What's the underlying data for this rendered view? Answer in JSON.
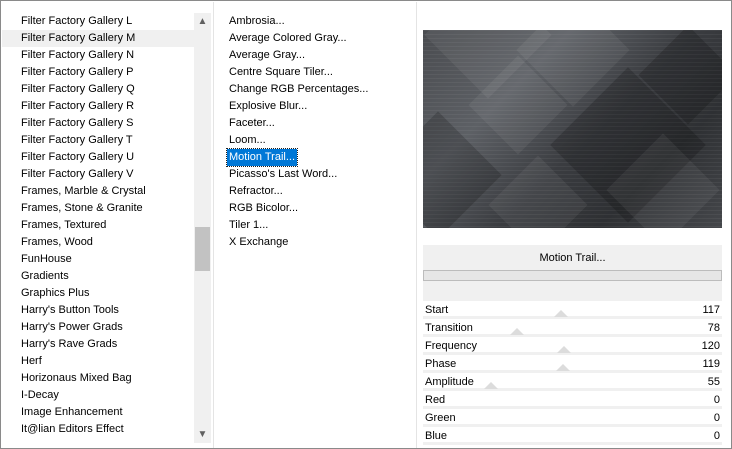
{
  "categories": {
    "items": [
      "Filter Factory Gallery L",
      "Filter Factory Gallery M",
      "Filter Factory Gallery N",
      "Filter Factory Gallery P",
      "Filter Factory Gallery Q",
      "Filter Factory Gallery R",
      "Filter Factory Gallery S",
      "Filter Factory Gallery T",
      "Filter Factory Gallery U",
      "Filter Factory Gallery V",
      "Frames, Marble & Crystal",
      "Frames, Stone & Granite",
      "Frames, Textured",
      "Frames, Wood",
      "FunHouse",
      "Gradients",
      "Graphics Plus",
      "Harry's Button Tools",
      "Harry's Power Grads",
      "Harry's Rave Grads",
      "Herf",
      "Horizonaus Mixed Bag",
      "I-Decay",
      "Image Enhancement",
      "It@lian Editors Effect"
    ],
    "selected": "Filter Factory Gallery M",
    "scroll_up_icon": "chevron-up-icon",
    "scroll_down_icon": "chevron-down-icon"
  },
  "filters": {
    "items": [
      "Ambrosia...",
      "Average Colored Gray...",
      "Average Gray...",
      "Centre Square Tiler...",
      "Change RGB Percentages...",
      "Explosive Blur...",
      "Faceter...",
      "Loom...",
      "Motion Trail...",
      "Picasso's Last Word...",
      "Refractor...",
      "RGB Bicolor...",
      "Tiler 1...",
      "X Exchange"
    ],
    "selected": "Motion Trail..."
  },
  "preview": {
    "title": "Motion Trail..."
  },
  "params": [
    {
      "name": "Start",
      "value": "117",
      "level": 117
    },
    {
      "name": "Transition",
      "value": "78",
      "level": 78
    },
    {
      "name": "Frequency",
      "value": "120",
      "level": 120
    },
    {
      "name": "Phase",
      "value": "119",
      "level": 119
    },
    {
      "name": "Amplitude",
      "value": "55",
      "level": 55
    },
    {
      "name": "Red",
      "value": "0",
      "level": 0
    },
    {
      "name": "Green",
      "value": "0",
      "level": 0
    },
    {
      "name": "Blue",
      "value": "0",
      "level": 0
    }
  ],
  "colors": {
    "selection": "#0078d7",
    "panel_bg": "#f0f0f0"
  }
}
